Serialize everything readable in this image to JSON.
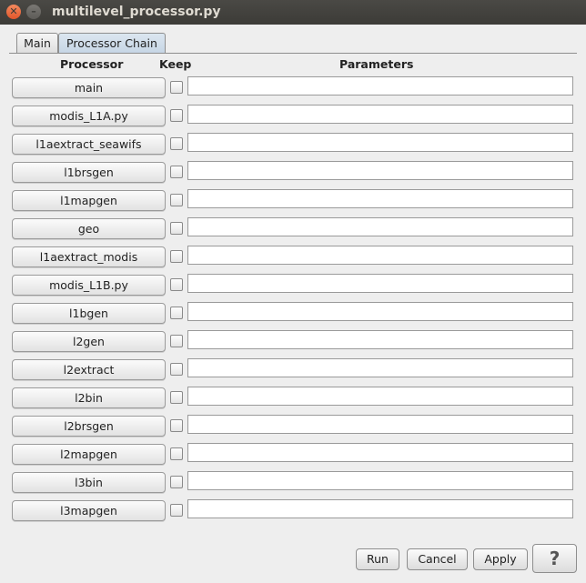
{
  "window": {
    "title": "multilevel_processor.py"
  },
  "tabs": [
    {
      "label": "Main",
      "selected": false
    },
    {
      "label": "Processor Chain",
      "selected": true
    }
  ],
  "headers": {
    "processor": "Processor",
    "keep": "Keep",
    "parameters": "Parameters"
  },
  "processors": [
    {
      "name": "main",
      "keep": false,
      "params": ""
    },
    {
      "name": "modis_L1A.py",
      "keep": false,
      "params": ""
    },
    {
      "name": "l1aextract_seawifs",
      "keep": false,
      "params": ""
    },
    {
      "name": "l1brsgen",
      "keep": false,
      "params": ""
    },
    {
      "name": "l1mapgen",
      "keep": false,
      "params": ""
    },
    {
      "name": "geo",
      "keep": false,
      "params": ""
    },
    {
      "name": "l1aextract_modis",
      "keep": false,
      "params": ""
    },
    {
      "name": "modis_L1B.py",
      "keep": false,
      "params": ""
    },
    {
      "name": "l1bgen",
      "keep": false,
      "params": ""
    },
    {
      "name": "l2gen",
      "keep": false,
      "params": ""
    },
    {
      "name": "l2extract",
      "keep": false,
      "params": ""
    },
    {
      "name": "l2bin",
      "keep": false,
      "params": ""
    },
    {
      "name": "l2brsgen",
      "keep": false,
      "params": ""
    },
    {
      "name": "l2mapgen",
      "keep": false,
      "params": ""
    },
    {
      "name": "l3bin",
      "keep": false,
      "params": ""
    },
    {
      "name": "l3mapgen",
      "keep": false,
      "params": ""
    }
  ],
  "buttons": {
    "run": "Run",
    "cancel": "Cancel",
    "apply": "Apply",
    "help": "?"
  },
  "icons": {
    "close": "close-icon",
    "minimize": "minimize-icon"
  }
}
